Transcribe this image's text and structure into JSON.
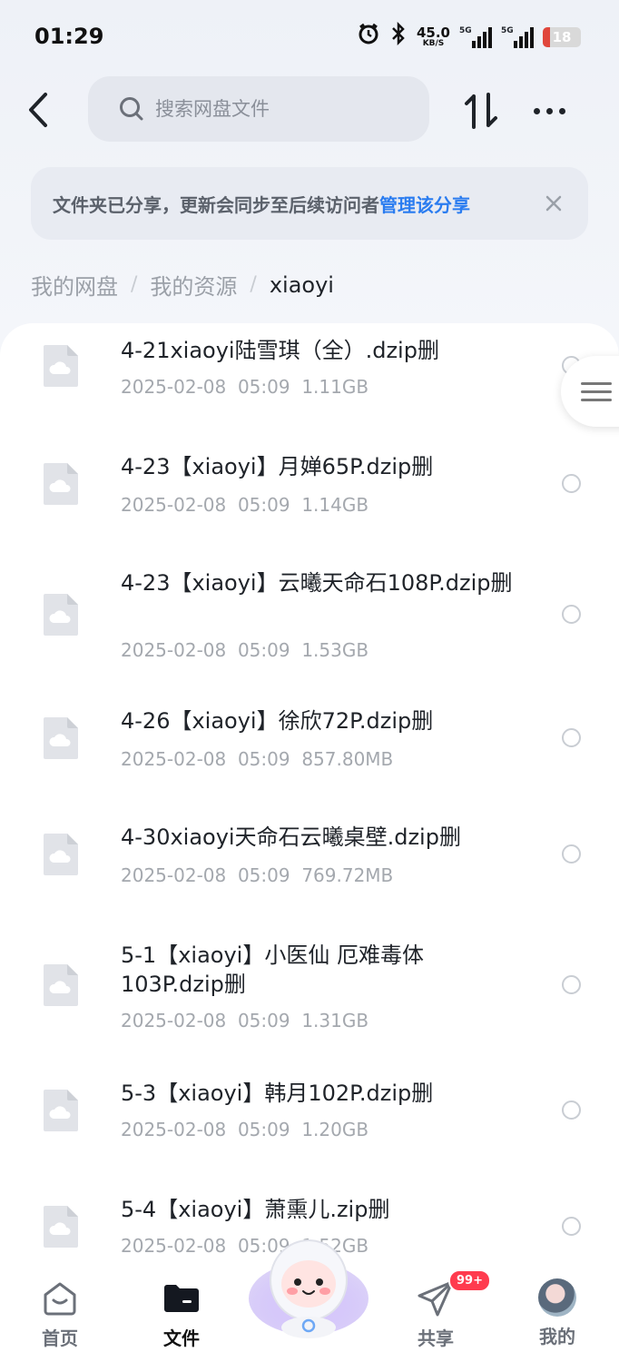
{
  "status_bar": {
    "time": "01:29",
    "net_speed_value": "45.0",
    "net_speed_unit": "KB/S",
    "sim1_tag": "5G",
    "sim2_tag": "5G",
    "battery": "18",
    "battery_level": 0.18,
    "icons": [
      "alarm-icon",
      "bluetooth-icon",
      "signal-icon",
      "battery-icon"
    ]
  },
  "top_bar": {
    "search_placeholder": "搜索网盘文件",
    "icons": [
      "back-arrow-icon",
      "search-icon",
      "sort-icon",
      "more-icon"
    ]
  },
  "banner": {
    "text": "文件夹已分享，更新会同步至后续访问者",
    "link": "管理该分享",
    "link_color": "#2a7cf0"
  },
  "breadcrumb": {
    "items": [
      "我的网盘",
      "我的资源",
      "xiaoyi"
    ],
    "separator": "/"
  },
  "files": [
    {
      "name": "4-21xiaoyi陆雪琪（全）.dzip删",
      "date": "2025-02-08  05:09",
      "size": "1.11GB"
    },
    {
      "name": "4-23【xiaoyi】月婵65P.dzip删",
      "date": "2025-02-08  05:09",
      "size": "1.14GB"
    },
    {
      "name": "4-23【xiaoyi】云曦天命石108P.dzip删",
      "date": "2025-02-08  05:09",
      "size": "1.53GB"
    },
    {
      "name": "4-26【xiaoyi】徐欣72P.dzip删",
      "date": "2025-02-08  05:09",
      "size": "857.80MB"
    },
    {
      "name": "4-30xiaoyi天命石云曦桌壁.dzip删",
      "date": "2025-02-08  05:09",
      "size": "769.72MB"
    },
    {
      "name": "5-1【xiaoyi】小医仙 厄难毒体103P.dzip删",
      "date": "2025-02-08  05:09",
      "size": "1.31GB"
    },
    {
      "name": "5-3【xiaoyi】韩月102P.dzip删",
      "date": "2025-02-08  05:09",
      "size": "1.20GB"
    },
    {
      "name": "5-4【xiaoyi】萧熏儿.zip删",
      "date": "2025-02-08  05:09",
      "size": "1.52GB"
    }
  ],
  "bottom_nav": {
    "items": [
      {
        "label": "首页",
        "icon": "home-icon"
      },
      {
        "label": "文件",
        "icon": "folder-icon",
        "active": true
      },
      {
        "label": "",
        "icon": "mascot-icon"
      },
      {
        "label": "共享",
        "icon": "send-icon"
      },
      {
        "label": "我的",
        "icon": "avatar"
      }
    ],
    "share_badge": "99+"
  }
}
